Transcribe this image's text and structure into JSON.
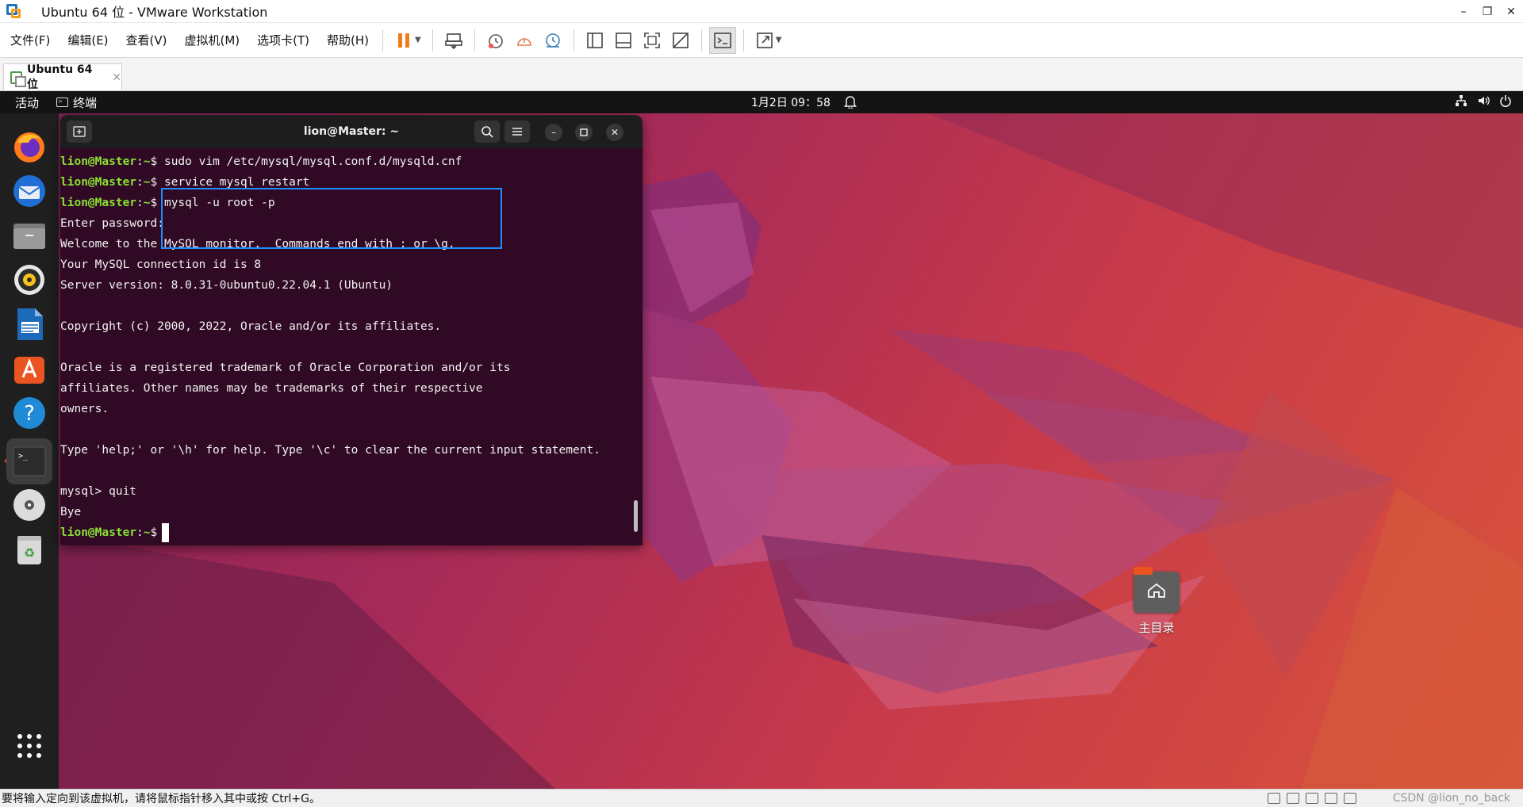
{
  "window": {
    "title": "Ubuntu 64 位 - VMware Workstation",
    "controls": [
      "–",
      "❐",
      "✕"
    ]
  },
  "menubar": {
    "items": [
      "文件(F)",
      "编辑(E)",
      "查看(V)",
      "虚拟机(M)",
      "选项卡(T)",
      "帮助(H)"
    ]
  },
  "toolbar": {
    "icons": [
      "pause-icon",
      "send-ctrl-alt-del-icon",
      "snapshot-take-icon",
      "snapshot-revert-icon",
      "snapshot-manager-icon",
      "view-console-icon",
      "view-thumbnail-icon",
      "fullscreen-icon",
      "unity-icon",
      "terminal-console-icon",
      "stretch-icon"
    ]
  },
  "tabs": [
    {
      "label": "Ubuntu 64 位",
      "close": "✕"
    }
  ],
  "guest": {
    "topbar": {
      "activities": "活动",
      "app_menu": "终端",
      "clock": "1月2日  09：58"
    },
    "dock": {
      "items": [
        "firefox",
        "thunderbird",
        "files",
        "rhythmbox",
        "libreoffice-writer",
        "app-center",
        "help",
        "terminal",
        "disc",
        "trash",
        "show-apps"
      ]
    },
    "terminal": {
      "title": "lion@Master: ~",
      "prompt_user": "lion@Master",
      "prompt_sep": ":",
      "prompt_path": "~",
      "prompt_symbol": "$",
      "commands": [
        "sudo vim /etc/mysql/mysql.conf.d/mysqld.cnf",
        "service mysql restart",
        "mysql -u root -p"
      ],
      "output": [
        "Enter password:",
        "Welcome to the MySQL monitor.  Commands end with ; or \\g.",
        "Your MySQL connection id is 8",
        "Server version: 8.0.31-0ubuntu0.22.04.1 (Ubuntu)",
        "",
        "Copyright (c) 2000, 2022, Oracle and/or its affiliates.",
        "",
        "Oracle is a registered trademark of Oracle Corporation and/or its",
        "affiliates. Other names may be trademarks of their respective",
        "owners.",
        "",
        "Type 'help;' or '\\h' for help. Type '\\c' to clear the current input statement.",
        "",
        "mysql> quit",
        "Bye"
      ]
    },
    "desktop": {
      "home_label": "主目录"
    }
  },
  "statusbar": {
    "message": "要将输入定向到该虚拟机，请将鼠标指针移入其中或按 Ctrl+G。",
    "watermark": "CSDN @lion_no_back"
  },
  "colors": {
    "terminal_bg": "#300a24",
    "prompt_green": "#8ae234",
    "highlight_box": "#1f8fff",
    "ubuntu_orange": "#e95420"
  }
}
